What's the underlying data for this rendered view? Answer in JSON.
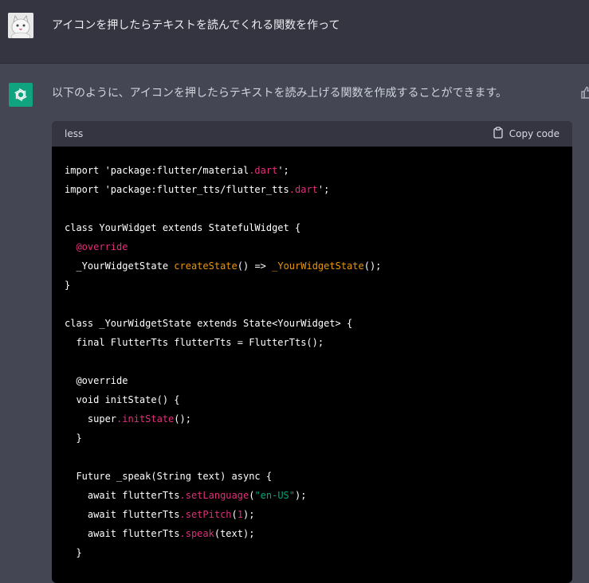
{
  "user": {
    "message": "アイコンを押したらテキストを読んでくれる関数を作って"
  },
  "assistant": {
    "message": "以下のように、アイコンを押したらテキストを読み上げる関数を作成することができます。",
    "code_block": {
      "language": "less",
      "copy_label": "Copy code",
      "lines": [
        [
          [
            "plain",
            "import 'package:flutter/material"
          ],
          [
            "red",
            ".dart"
          ],
          [
            "plain",
            "';"
          ]
        ],
        [
          [
            "plain",
            "import 'package:flutter_tts/flutter_tts"
          ],
          [
            "red",
            ".dart"
          ],
          [
            "plain",
            "';"
          ]
        ],
        [],
        [
          [
            "plain",
            "class YourWidget extends StatefulWidget {"
          ]
        ],
        [
          [
            "plain",
            "  "
          ],
          [
            "red",
            "@override"
          ]
        ],
        [
          [
            "plain",
            "  _YourWidgetState "
          ],
          [
            "orange",
            "createState"
          ],
          [
            "plain",
            "() => "
          ],
          [
            "orange",
            "_YourWidgetState"
          ],
          [
            "plain",
            "();"
          ]
        ],
        [
          [
            "plain",
            "}"
          ]
        ],
        [],
        [
          [
            "plain",
            "class _YourWidgetState extends State<YourWidget> {"
          ]
        ],
        [
          [
            "plain",
            "  final FlutterTts flutterTts = FlutterTts();"
          ]
        ],
        [],
        [
          [
            "plain",
            "  @override"
          ]
        ],
        [
          [
            "plain",
            "  void initState() {"
          ]
        ],
        [
          [
            "plain",
            "    super"
          ],
          [
            "red",
            ".initState"
          ],
          [
            "plain",
            "();"
          ]
        ],
        [
          [
            "plain",
            "  }"
          ]
        ],
        [],
        [
          [
            "plain",
            "  Future _speak(String text) async {"
          ]
        ],
        [
          [
            "plain",
            "    await flutterTts"
          ],
          [
            "red",
            ".setLanguage"
          ],
          [
            "plain",
            "("
          ],
          [
            "green",
            "\"en-US\""
          ],
          [
            "plain",
            ");"
          ]
        ],
        [
          [
            "plain",
            "    await flutterTts"
          ],
          [
            "red",
            ".setPitch"
          ],
          [
            "plain",
            "("
          ],
          [
            "red",
            "1"
          ],
          [
            "plain",
            ");"
          ]
        ],
        [
          [
            "plain",
            "    await flutterTts"
          ],
          [
            "red",
            ".speak"
          ],
          [
            "plain",
            "(text);"
          ]
        ],
        [
          [
            "plain",
            "  }"
          ]
        ]
      ]
    }
  },
  "colors": {
    "user_bg": "#343541",
    "assistant_bg": "#444654",
    "brand_green": "#10a37f",
    "code_bg": "#000000",
    "code_header_bg": "#343541"
  },
  "icons": {
    "avatar": "user-avatar-icon",
    "logo": "openai-logo-icon",
    "copy": "clipboard-icon",
    "feedback": "thumbs-up-icon"
  }
}
